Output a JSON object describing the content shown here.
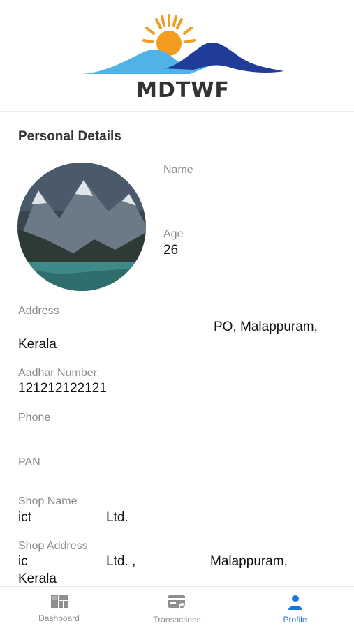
{
  "header": {
    "logo_text": "MDTWF",
    "colors": {
      "sun": "#f39c1f",
      "wave_light": "#4fb3e6",
      "wave_dark": "#1f3c99"
    }
  },
  "profile": {
    "section_title": "Personal Details",
    "name_label": "Name",
    "name_value": "",
    "age_label": "Age",
    "age_value": "26",
    "address_label": "Address",
    "address_line1": "PO, Malappuram,",
    "address_line2": "Kerala",
    "aadhar_label": "Aadhar Number",
    "aadhar_value": "121212122121",
    "phone_label": "Phone",
    "phone_value": "",
    "pan_label": "PAN",
    "pan_value": "",
    "shop_name_label": "Shop Name",
    "shop_name_start": "ict",
    "shop_name_end": "Ltd.",
    "shop_address_label": "Shop Address",
    "shop_address_start": "ic",
    "shop_address_mid": "Ltd. ,",
    "shop_address_end": "Malappuram,",
    "shop_address_line2": "Kerala"
  },
  "nav": {
    "items": [
      {
        "label": "Dashboard",
        "icon": "dashboard-icon",
        "active": false
      },
      {
        "label": "Transactions",
        "icon": "transactions-icon",
        "active": false
      },
      {
        "label": "Profile",
        "icon": "profile-icon",
        "active": true
      }
    ],
    "active_color": "#1a73e8",
    "inactive_color": "#8e8e8e"
  }
}
